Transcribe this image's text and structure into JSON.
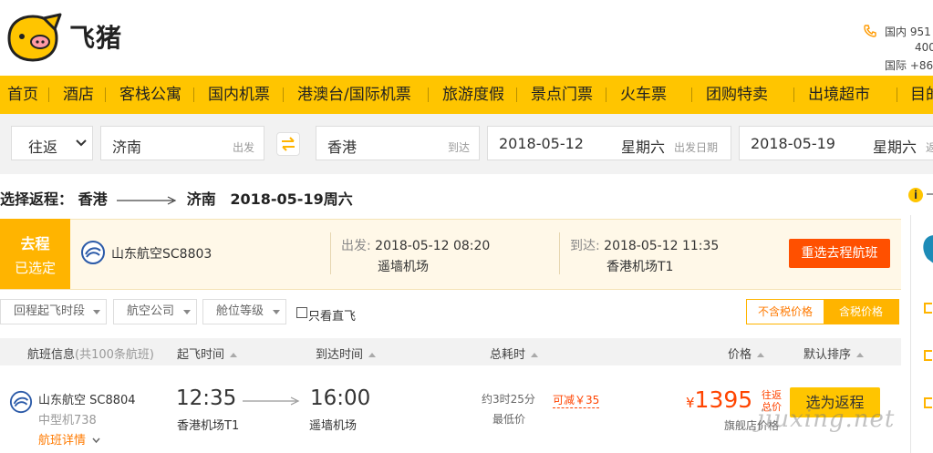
{
  "header": {
    "logo_text": "飞猪",
    "phone": {
      "domestic_label": "国内",
      "domestic_number_1": "951",
      "domestic_number_2": "400",
      "intl_label": "国际",
      "intl_number": "+86"
    }
  },
  "nav": {
    "items": [
      "首页",
      "酒店",
      "客栈公寓",
      "国内机票",
      "港澳台/国际机票",
      "旅游度假",
      "景点门票",
      "火车票",
      "团购特卖",
      "出境超市",
      "目的"
    ]
  },
  "search": {
    "trip_type": "往返",
    "from_city": "济南",
    "from_hint": "出发",
    "to_city": "香港",
    "to_hint": "到达",
    "depart_date": "2018-05-12",
    "depart_weekday": "星期六",
    "depart_hint": "出发日期",
    "return_date": "2018-05-19",
    "return_weekday": "星期六",
    "return_hint": "返"
  },
  "title": {
    "prefix": "选择返程：",
    "from": "香港",
    "to": "济南",
    "date": "2018-05-19周六"
  },
  "outbound": {
    "badge_line1": "去程",
    "badge_line2": "已选定",
    "airline": "山东航空SC8803",
    "depart_label": "出发:",
    "depart_time": "2018-05-12 08:20",
    "depart_airport": "遥墙机场",
    "arrive_label": "到达:",
    "arrive_time": "2018-05-12 11:35",
    "arrive_airport": "香港机场T1",
    "reselect": "重选去程航班"
  },
  "filters": {
    "time": "回程起飞时段",
    "airline": "航空公司",
    "cabin": "舱位等级",
    "direct_only": "只看直飞",
    "price_excl_tax": "不含税价格",
    "price_incl_tax": "含税价格"
  },
  "table_header": {
    "info": "航班信息",
    "count": "(共100条航班)",
    "depart": "起飞时间",
    "arrive": "到达时间",
    "duration": "总耗时",
    "price": "价格",
    "sort": "默认排序"
  },
  "flights": [
    {
      "airline": "山东航空",
      "flight_no": "SC8804",
      "aircraft": "中型机738",
      "details": "航班详情",
      "depart_time": "12:35",
      "depart_airport": "香港机场T1",
      "arrive_time": "16:00",
      "arrive_airport": "遥墙机场",
      "duration": "约3时25分",
      "lowest": "最低价",
      "discount": "可减￥35",
      "currency": "¥",
      "price": "1395",
      "price_tag_1": "往返",
      "price_tag_2": "总价",
      "store": "旗舰店价格",
      "choose": "选为返程"
    }
  ],
  "watermark": "jiuxing.net",
  "colors": {
    "brand_yellow": "#ffc500",
    "accent_orange": "#ff5000",
    "price_red": "#ff4400"
  }
}
